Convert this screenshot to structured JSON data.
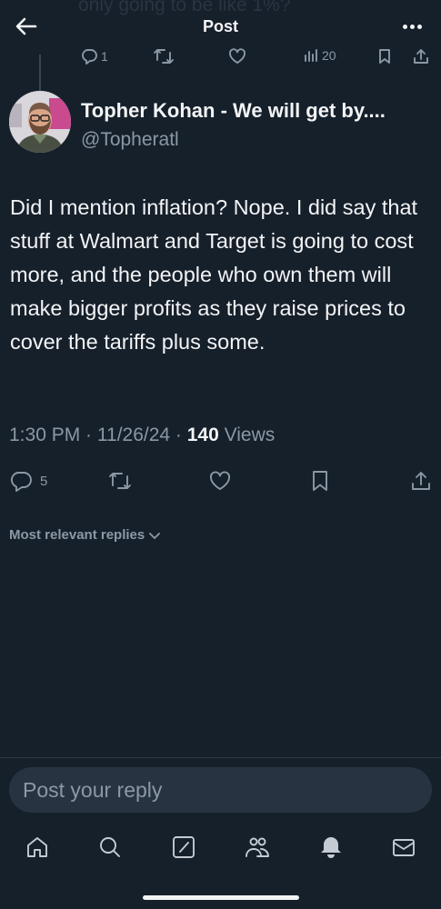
{
  "ghost": {
    "parent_text": "only going to be like 1%?"
  },
  "header": {
    "title": "Post",
    "back_icon": "arrow-left-icon",
    "more_icon": "more-horizontal-icon"
  },
  "parent_tweet": {
    "reply_count": "1",
    "view_count": "20"
  },
  "post": {
    "author_name": "Topher Kohan - We will get by....",
    "author_handle": "@Topheratl",
    "text": "Did I mention inflation? Nope. I did say that stuff at Walmart and Target is going to cost more, and the people who own them will make bigger profits as they raise prices to cover the tariffs plus some.",
    "time": "1:30 PM",
    "date": "11/26/24",
    "views_count": "140",
    "views_label": "Views",
    "reply_count": "5"
  },
  "replies": {
    "sort_label": "Most relevant replies"
  },
  "reply_box": {
    "placeholder": "Post your reply"
  },
  "tabbar": {
    "items": [
      "home-icon",
      "search-icon",
      "grok-icon",
      "communities-icon",
      "notifications-icon",
      "messages-icon"
    ]
  },
  "colors": {
    "background": "#16202b",
    "text": "#f3f4f5",
    "muted": "#8b98a5",
    "input": "#273340"
  }
}
